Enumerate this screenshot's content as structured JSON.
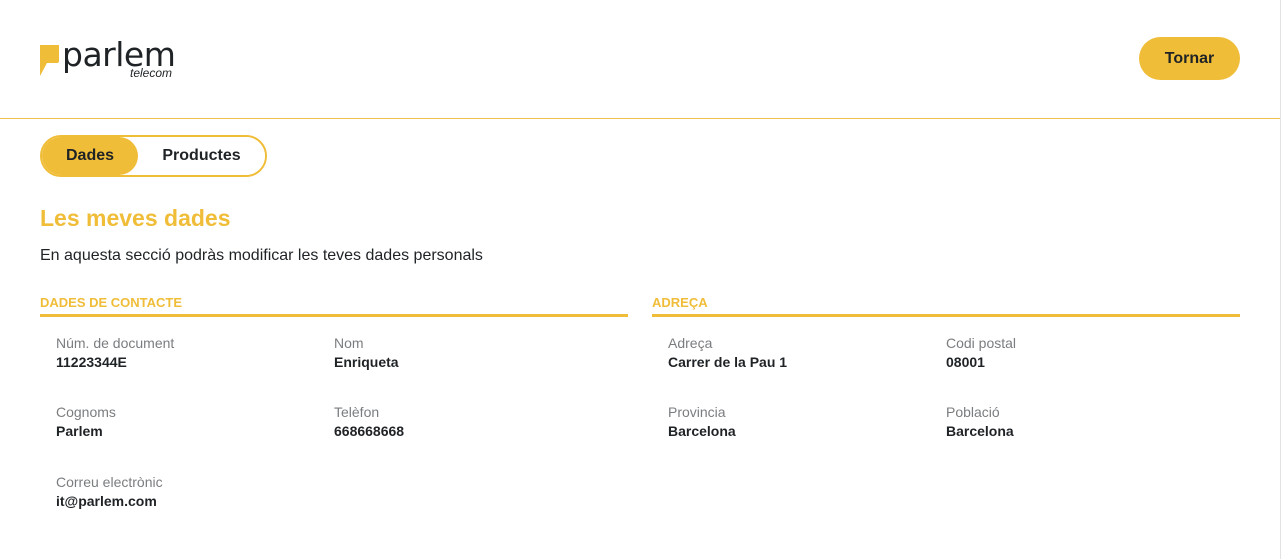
{
  "header": {
    "logo_word": "parlem",
    "logo_sub": "telecom",
    "back_label": "Tornar"
  },
  "tabs": [
    {
      "label": "Dades",
      "active": true
    },
    {
      "label": "Productes",
      "active": false
    }
  ],
  "page": {
    "title": "Les meves dades",
    "subtitle": "En aquesta secció podràs modificar les teves dades personals"
  },
  "contact": {
    "heading": "DADES DE CONTACTE",
    "fields": [
      {
        "label": "Núm. de document",
        "value": "11223344E"
      },
      {
        "label": "Nom",
        "value": "Enriqueta"
      },
      {
        "label": "Cognoms",
        "value": "Parlem"
      },
      {
        "label": "Telèfon",
        "value": "668668668"
      },
      {
        "label": "Correu electrònic",
        "value": "it@parlem.com"
      }
    ]
  },
  "address": {
    "heading": "ADREÇA",
    "fields": [
      {
        "label": "Adreça",
        "value": "Carrer de la Pau 1"
      },
      {
        "label": "Codi postal",
        "value": "08001"
      },
      {
        "label": "Provincia",
        "value": "Barcelona"
      },
      {
        "label": "Població",
        "value": "Barcelona"
      }
    ]
  },
  "colors": {
    "accent": "#f0bd38",
    "text": "#1f2326",
    "label": "#7a7d80"
  }
}
